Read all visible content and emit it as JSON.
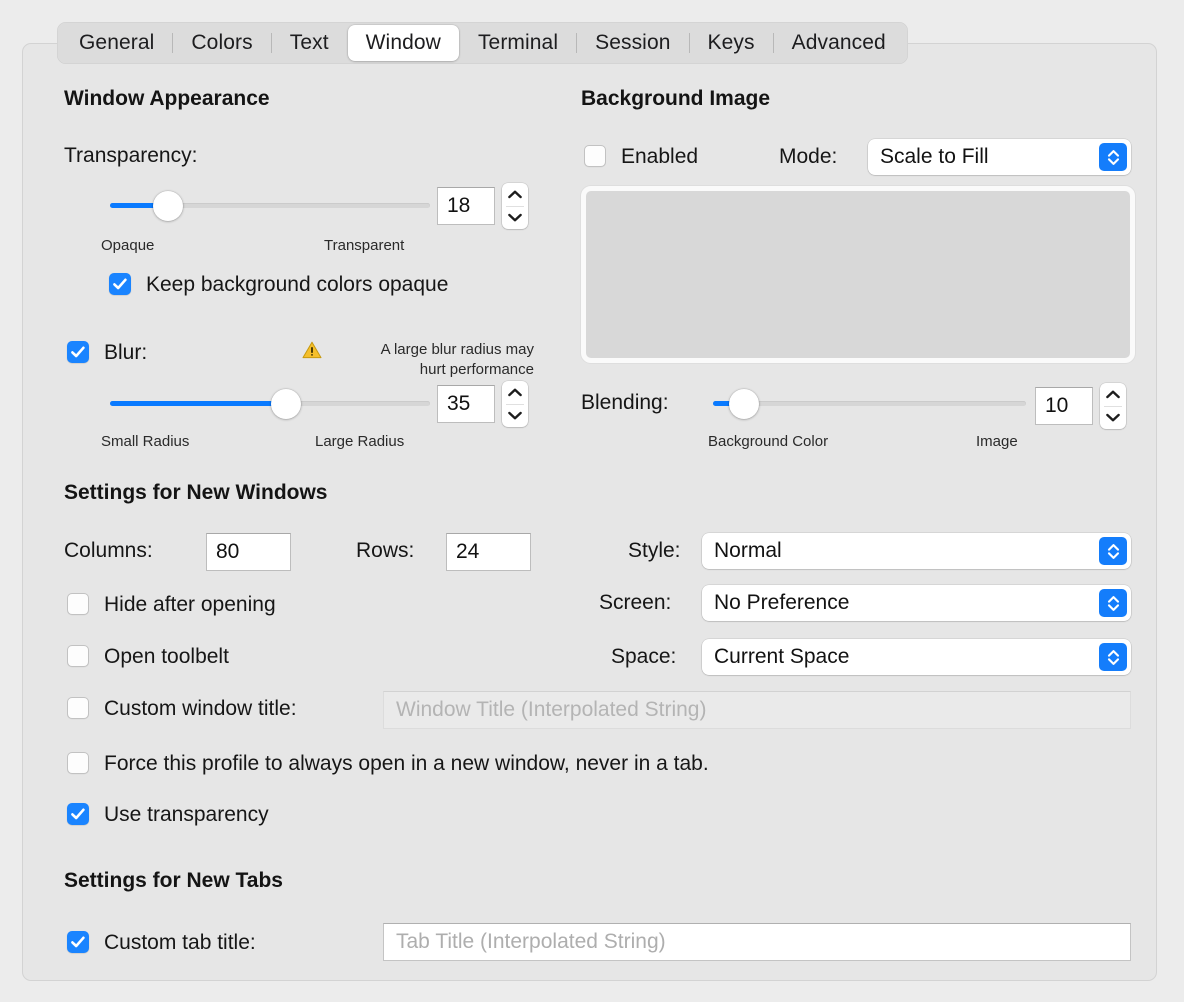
{
  "tabs": [
    {
      "label": "General",
      "selected": false
    },
    {
      "label": "Colors",
      "selected": false
    },
    {
      "label": "Text",
      "selected": false
    },
    {
      "label": "Window",
      "selected": true
    },
    {
      "label": "Terminal",
      "selected": false
    },
    {
      "label": "Session",
      "selected": false
    },
    {
      "label": "Keys",
      "selected": false
    },
    {
      "label": "Advanced",
      "selected": false
    }
  ],
  "window_appearance": {
    "title": "Window Appearance",
    "transparency": {
      "label": "Transparency:",
      "value": "18",
      "min_label": "Opaque",
      "max_label": "Transparent",
      "percent": 18
    },
    "keep_bg_opaque": {
      "label": "Keep background colors opaque",
      "checked": true
    },
    "blur": {
      "label": "Blur:",
      "checked": true,
      "value": "35",
      "min_label": "Small Radius",
      "max_label": "Large Radius",
      "percent": 55,
      "warning": "A large blur radius may\nhurt performance"
    }
  },
  "background_image": {
    "title": "Background Image",
    "enabled": {
      "label": "Enabled",
      "checked": false
    },
    "mode": {
      "label": "Mode:",
      "value": "Scale to Fill"
    },
    "blending": {
      "label": "Blending:",
      "value": "10",
      "min_label": "Background Color",
      "max_label": "Image",
      "percent": 10
    }
  },
  "new_windows": {
    "title": "Settings for New Windows",
    "columns": {
      "label": "Columns:",
      "value": "80"
    },
    "rows": {
      "label": "Rows:",
      "value": "24"
    },
    "hide_after_opening": {
      "label": "Hide after opening",
      "checked": false
    },
    "open_toolbelt": {
      "label": "Open toolbelt",
      "checked": false
    },
    "custom_window_title": {
      "label": "Custom window title:",
      "checked": false,
      "placeholder": "Window Title (Interpolated String)",
      "value": ""
    },
    "force_new_window": {
      "label": "Force this profile to always open in a new window, never in a tab.",
      "checked": false
    },
    "use_transparency": {
      "label": "Use transparency",
      "checked": true
    },
    "style": {
      "label": "Style:",
      "value": "Normal"
    },
    "screen": {
      "label": "Screen:",
      "value": "No Preference"
    },
    "space": {
      "label": "Space:",
      "value": "Current Space"
    }
  },
  "new_tabs": {
    "title": "Settings for New Tabs",
    "custom_tab_title": {
      "label": "Custom tab title:",
      "checked": true,
      "placeholder": "Tab Title (Interpolated String)",
      "value": ""
    }
  },
  "colors": {
    "accent": "#097aff",
    "checkbox_on": "#1a84ff",
    "popup_arrow": "#147dfb",
    "warning": "#f5bf2b",
    "panel_bg": "#e6e6e6",
    "window_bg": "#ececec"
  }
}
